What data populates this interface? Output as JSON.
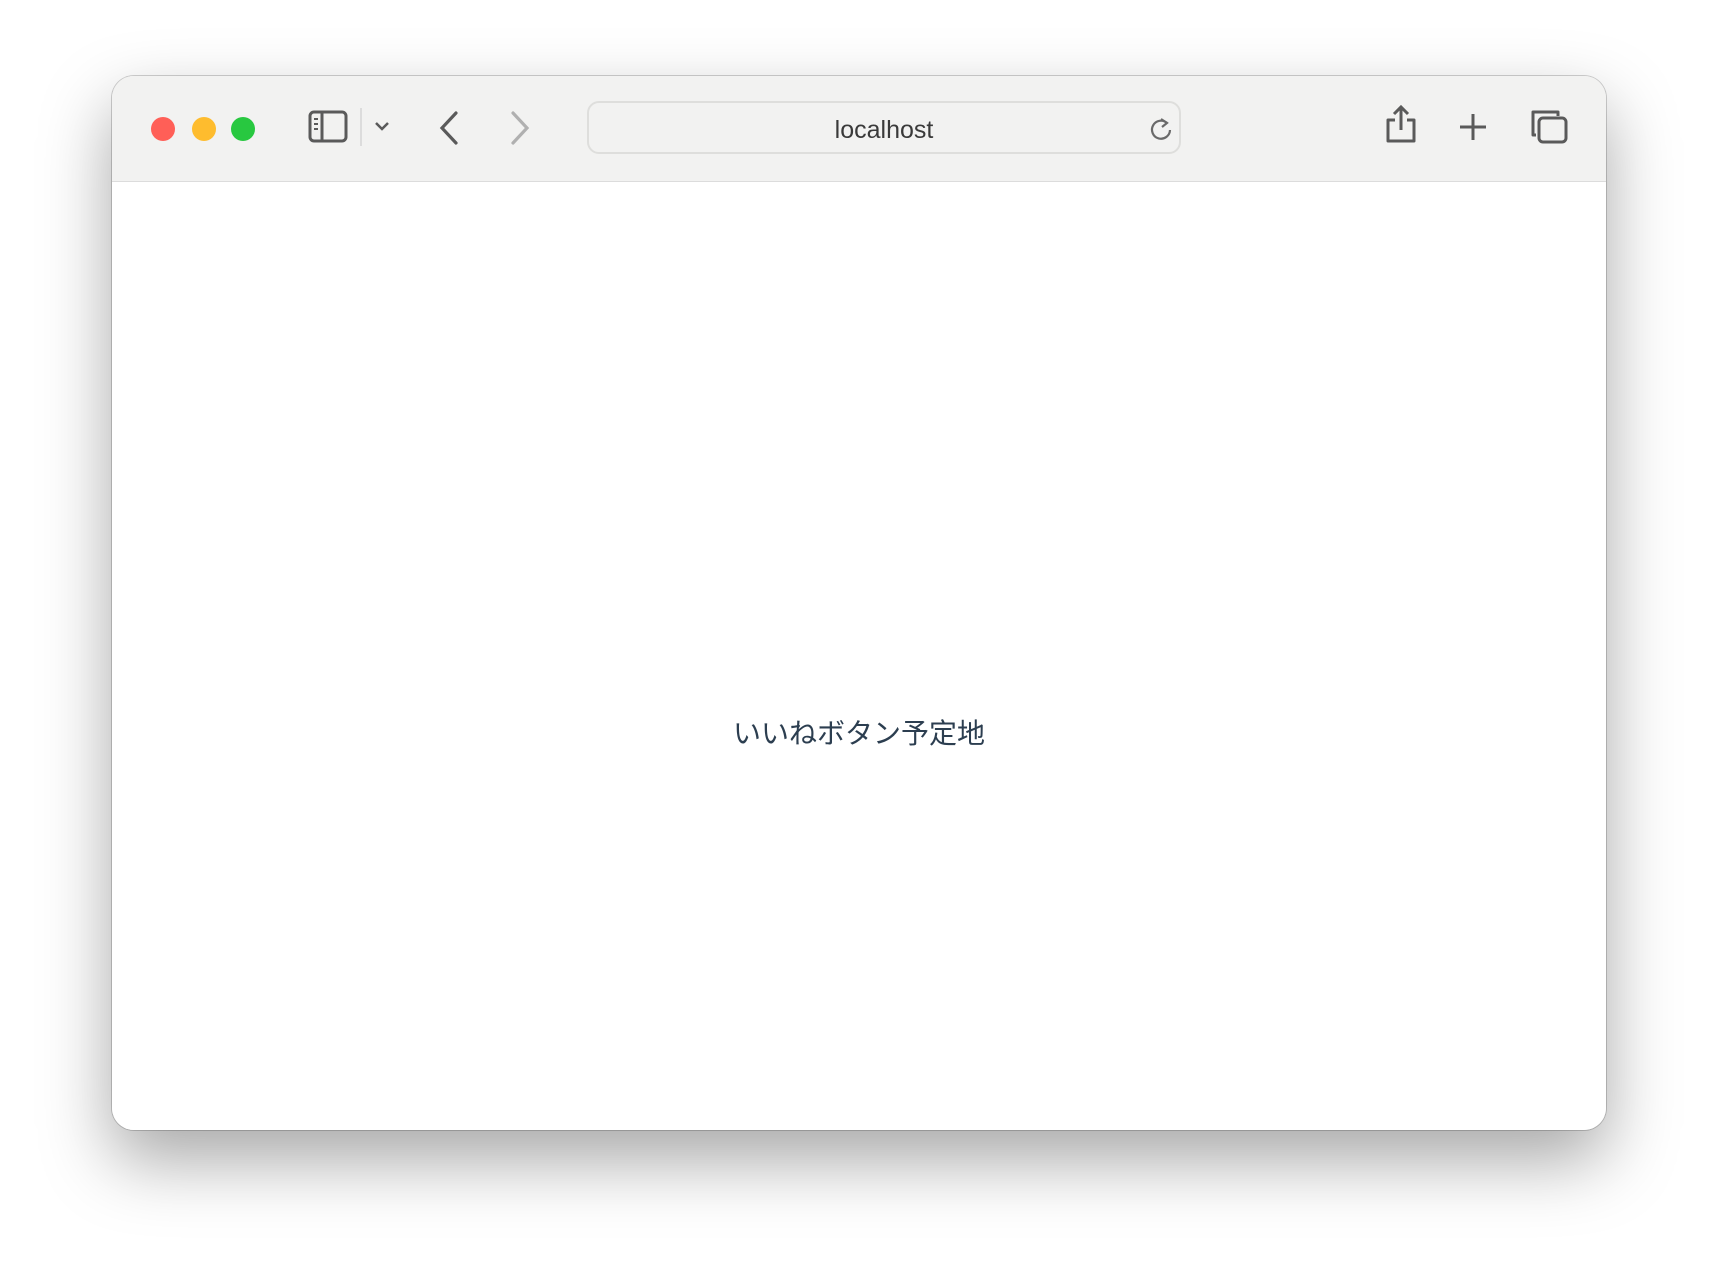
{
  "browser": {
    "address_bar": {
      "url": "localhost"
    },
    "traffic_lights": {
      "close_color": "#ff5f57",
      "minimize_color": "#febc2e",
      "zoom_color": "#28c840"
    }
  },
  "page": {
    "placeholder_text": "いいねボタン予定地",
    "text_color": "#2c3e50"
  }
}
